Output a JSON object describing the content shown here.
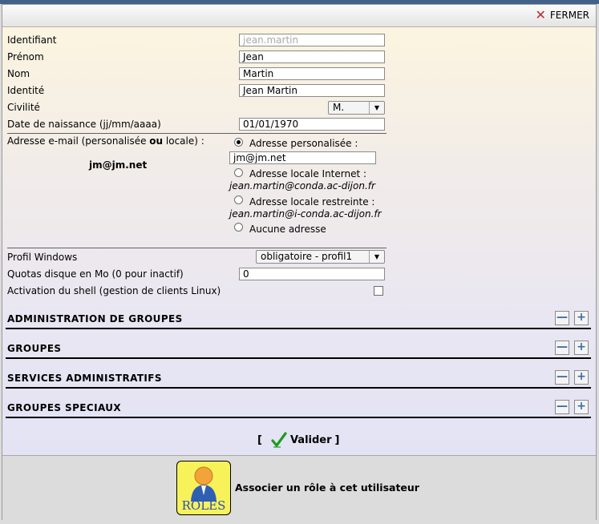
{
  "header": {
    "close_label": "FERMER"
  },
  "form": {
    "identifiant": {
      "label": "Identifiant",
      "value": "jean.martin"
    },
    "prenom": {
      "label": "Prénom",
      "value": "Jean"
    },
    "nom": {
      "label": "Nom",
      "value": "Martin"
    },
    "identite": {
      "label": "Identité",
      "value": "Jean Martin"
    },
    "civilite": {
      "label": "Civilité",
      "value": "M."
    },
    "naissance": {
      "label": "Date de naissance (jj/mm/aaaa)",
      "value": "01/01/1970"
    },
    "email": {
      "label_pre": "Adresse e-mail (personalisée ",
      "label_bold": "ou",
      "label_post": " locale) :",
      "current": "jm@jm.net",
      "opt_perso": "Adresse personalisée :",
      "perso_value": "jm@jm.net",
      "opt_internet": "Adresse locale Internet :",
      "internet_address": "jean.martin@conda.ac-dijon.fr",
      "opt_restreinte": "Adresse locale restreinte :",
      "restreinte_address": "jean.martin@i-conda.ac-dijon.fr",
      "opt_aucune": "Aucune adresse"
    },
    "profil": {
      "label": "Profil Windows",
      "value": "obligatoire - profil1"
    },
    "quota": {
      "label": "Quotas disque en Mo (0 pour inactif)",
      "value": "0"
    },
    "shell": {
      "label": "Activation du shell (gestion de clients Linux)"
    }
  },
  "sections": {
    "admin_groupes": "ADMINISTRATION DE GROUPES",
    "groupes": "GROUPES",
    "services": "SERVICES ADMINISTRATIFS",
    "speciaux": "GROUPES SPECIAUX",
    "minus": "—",
    "plus": "+"
  },
  "validate": {
    "open": "[",
    "label": "Valider",
    "close": "]"
  },
  "roles": {
    "button_text": "RÔLES",
    "description": "Associer un rôle à cet utilisateur"
  },
  "colors": {
    "accent": "#3a6aa8",
    "close": "#c0282d",
    "check": "#1f9a1f",
    "roles_bg": "#f7f25a"
  }
}
